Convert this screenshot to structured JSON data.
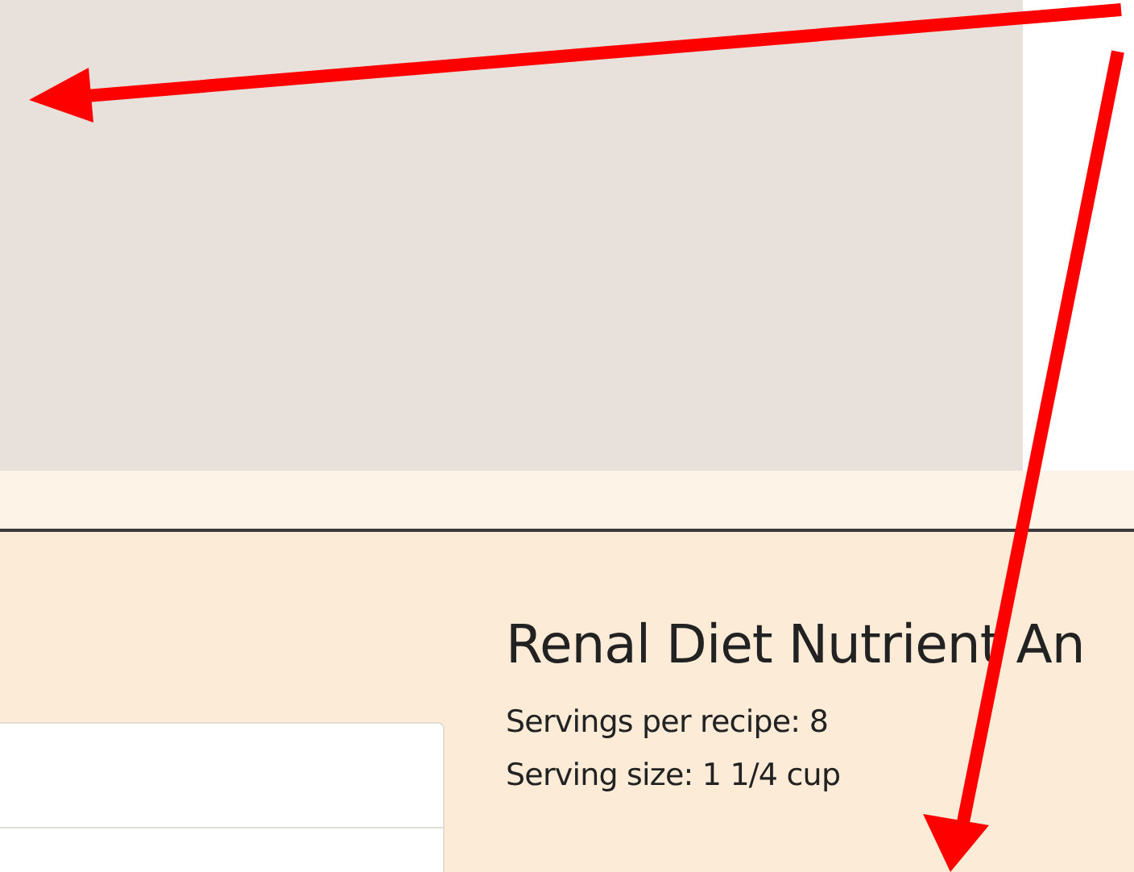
{
  "nutrient_panel": {
    "title": "Renal Diet Nutrient An",
    "servings_per_recipe": "Servings per recipe: 8",
    "serving_size": "Serving size: 1 1/4 cup"
  }
}
